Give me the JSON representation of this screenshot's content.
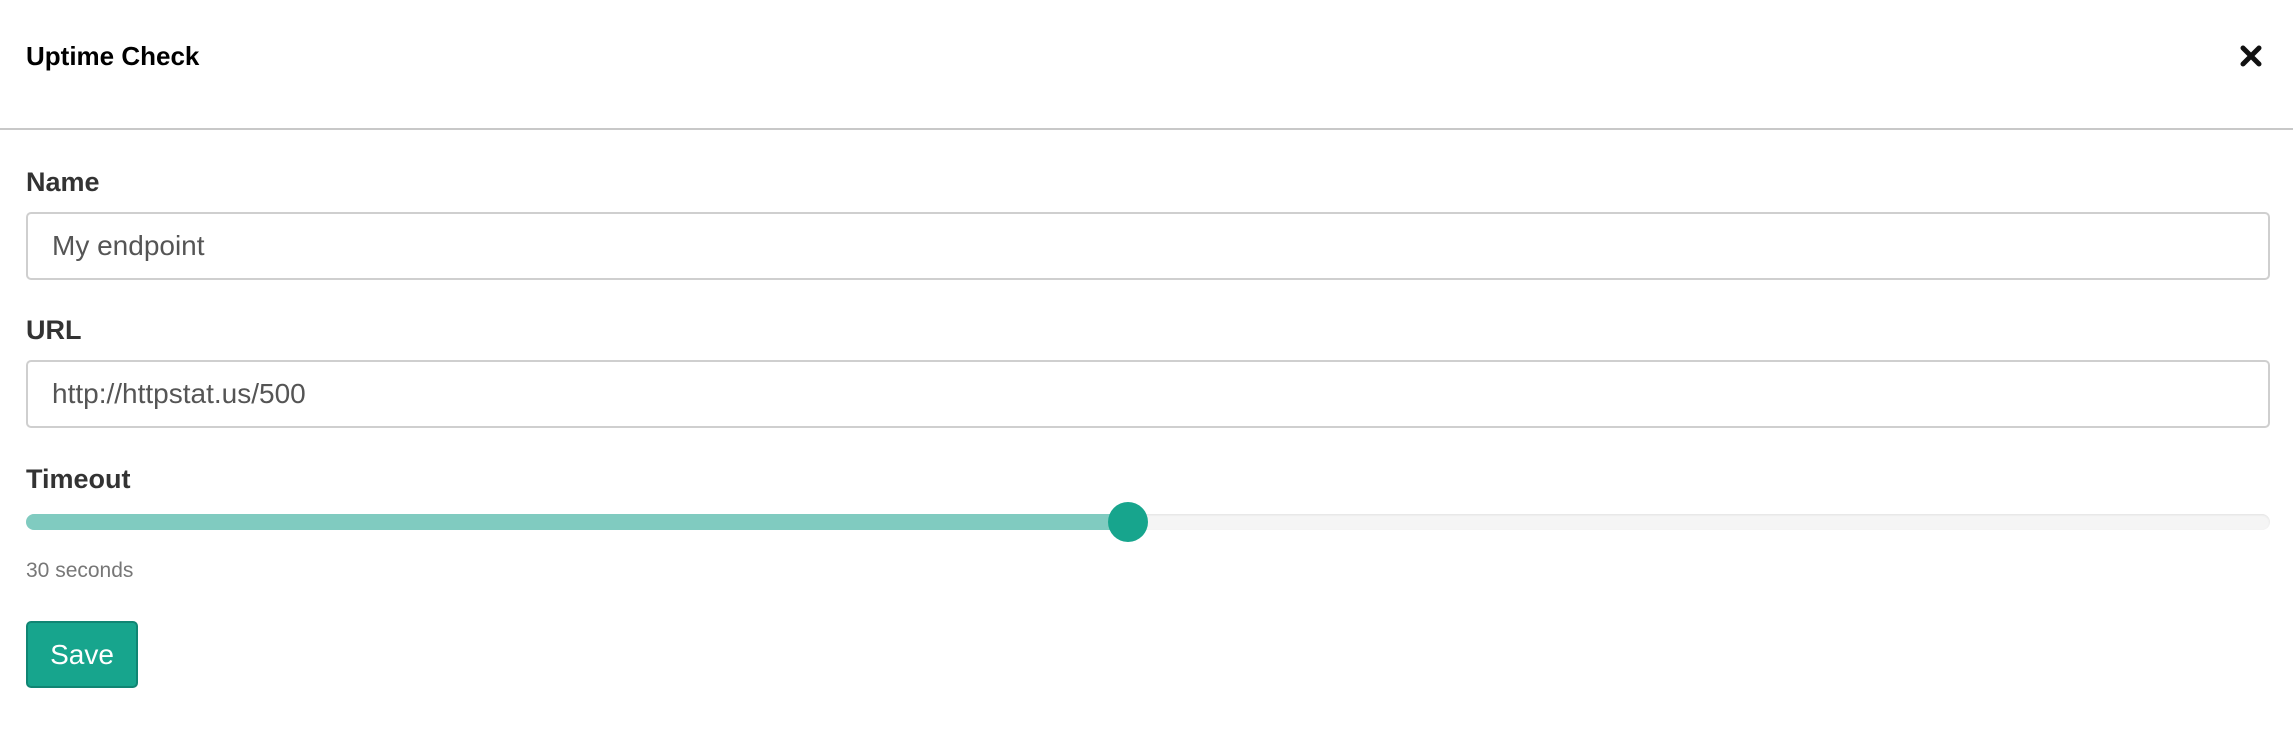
{
  "modal": {
    "title": "Uptime Check",
    "close_icon": "close-x-icon"
  },
  "form": {
    "name": {
      "label": "Name",
      "value": "My endpoint"
    },
    "url": {
      "label": "URL",
      "value": "http://httpstat.us/500"
    },
    "timeout": {
      "label": "Timeout",
      "fraction": 0.491,
      "hint": "30 seconds"
    },
    "save_label": "Save"
  },
  "colors": {
    "accent": "#17a58d",
    "accent_light": "#80cbc0",
    "track": "#f5f5f5",
    "border": "#cfcfcf"
  }
}
